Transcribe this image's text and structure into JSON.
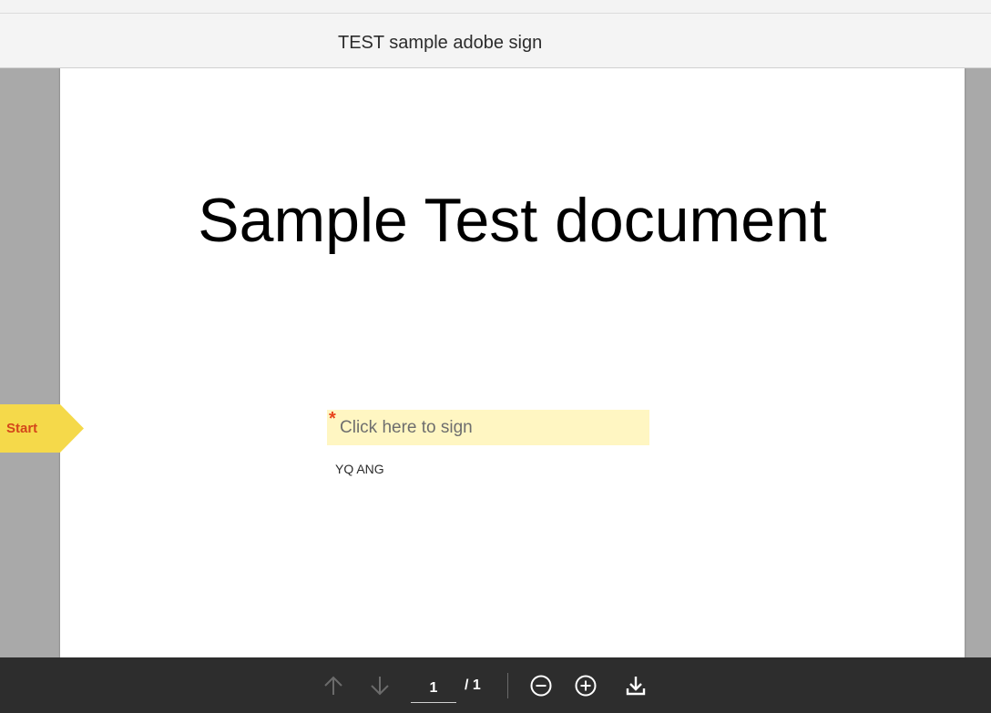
{
  "header": {
    "document_title": "TEST sample adobe sign"
  },
  "document": {
    "heading": "Sample Test document",
    "signature_field": {
      "required_marker": "*",
      "label": "Click here to sign"
    },
    "signer_name": "YQ ANG"
  },
  "start_tab": {
    "label": "Start",
    "color": "#f5d94a",
    "text_color": "#d4461a"
  },
  "toolbar": {
    "prev_page_icon": "arrow-up-icon",
    "next_page_icon": "arrow-down-icon",
    "current_page": "1",
    "page_total": "/ 1",
    "zoom_out_icon": "zoom-out-icon",
    "zoom_in_icon": "zoom-in-icon",
    "download_icon": "download-icon"
  },
  "colors": {
    "toolbar_bg": "#2d2d2d",
    "viewer_bg": "#a9a9a9",
    "sign_field_bg": "#fff6c2",
    "required_star": "#e8431c"
  }
}
